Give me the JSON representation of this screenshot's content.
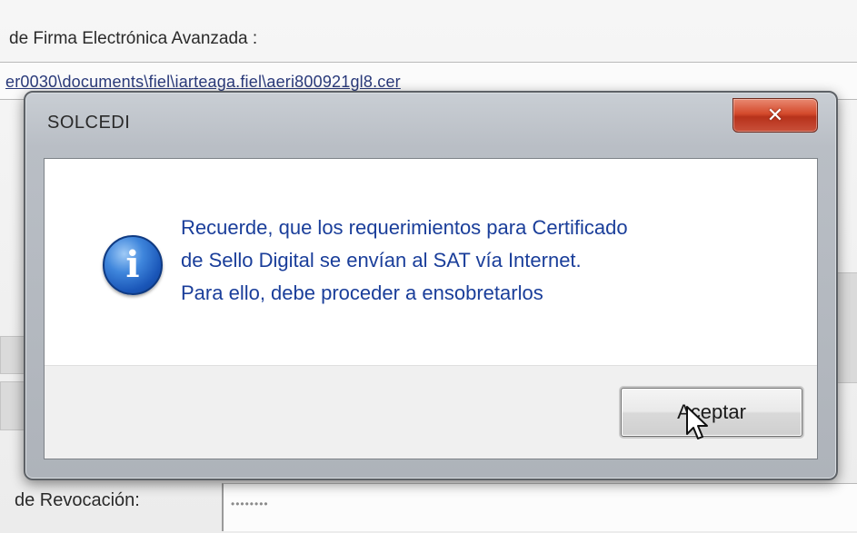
{
  "background": {
    "field_label": "de Firma Electrónica Avanzada :",
    "file_path": "er0030\\documents\\fiel\\iarteaga.fiel\\aeri800921gl8.cer",
    "revocation_label": "de Revocación:",
    "revocation_value": "••••••••"
  },
  "dialog": {
    "title": "SOLCEDI",
    "close_label": "✕",
    "message_lines": [
      "Recuerde, que los requerimientos para Certificado",
      "de Sello Digital se envían al SAT vía Internet.",
      "Para ello, debe proceder a ensobretarlos"
    ],
    "ok_label": "Aceptar",
    "icon": "information-icon",
    "cursor": "arrow-cursor-icon"
  },
  "colors": {
    "message_text": "#1a3e9a",
    "close_button": "#d44a2c",
    "info_icon": "#1a56b8"
  }
}
